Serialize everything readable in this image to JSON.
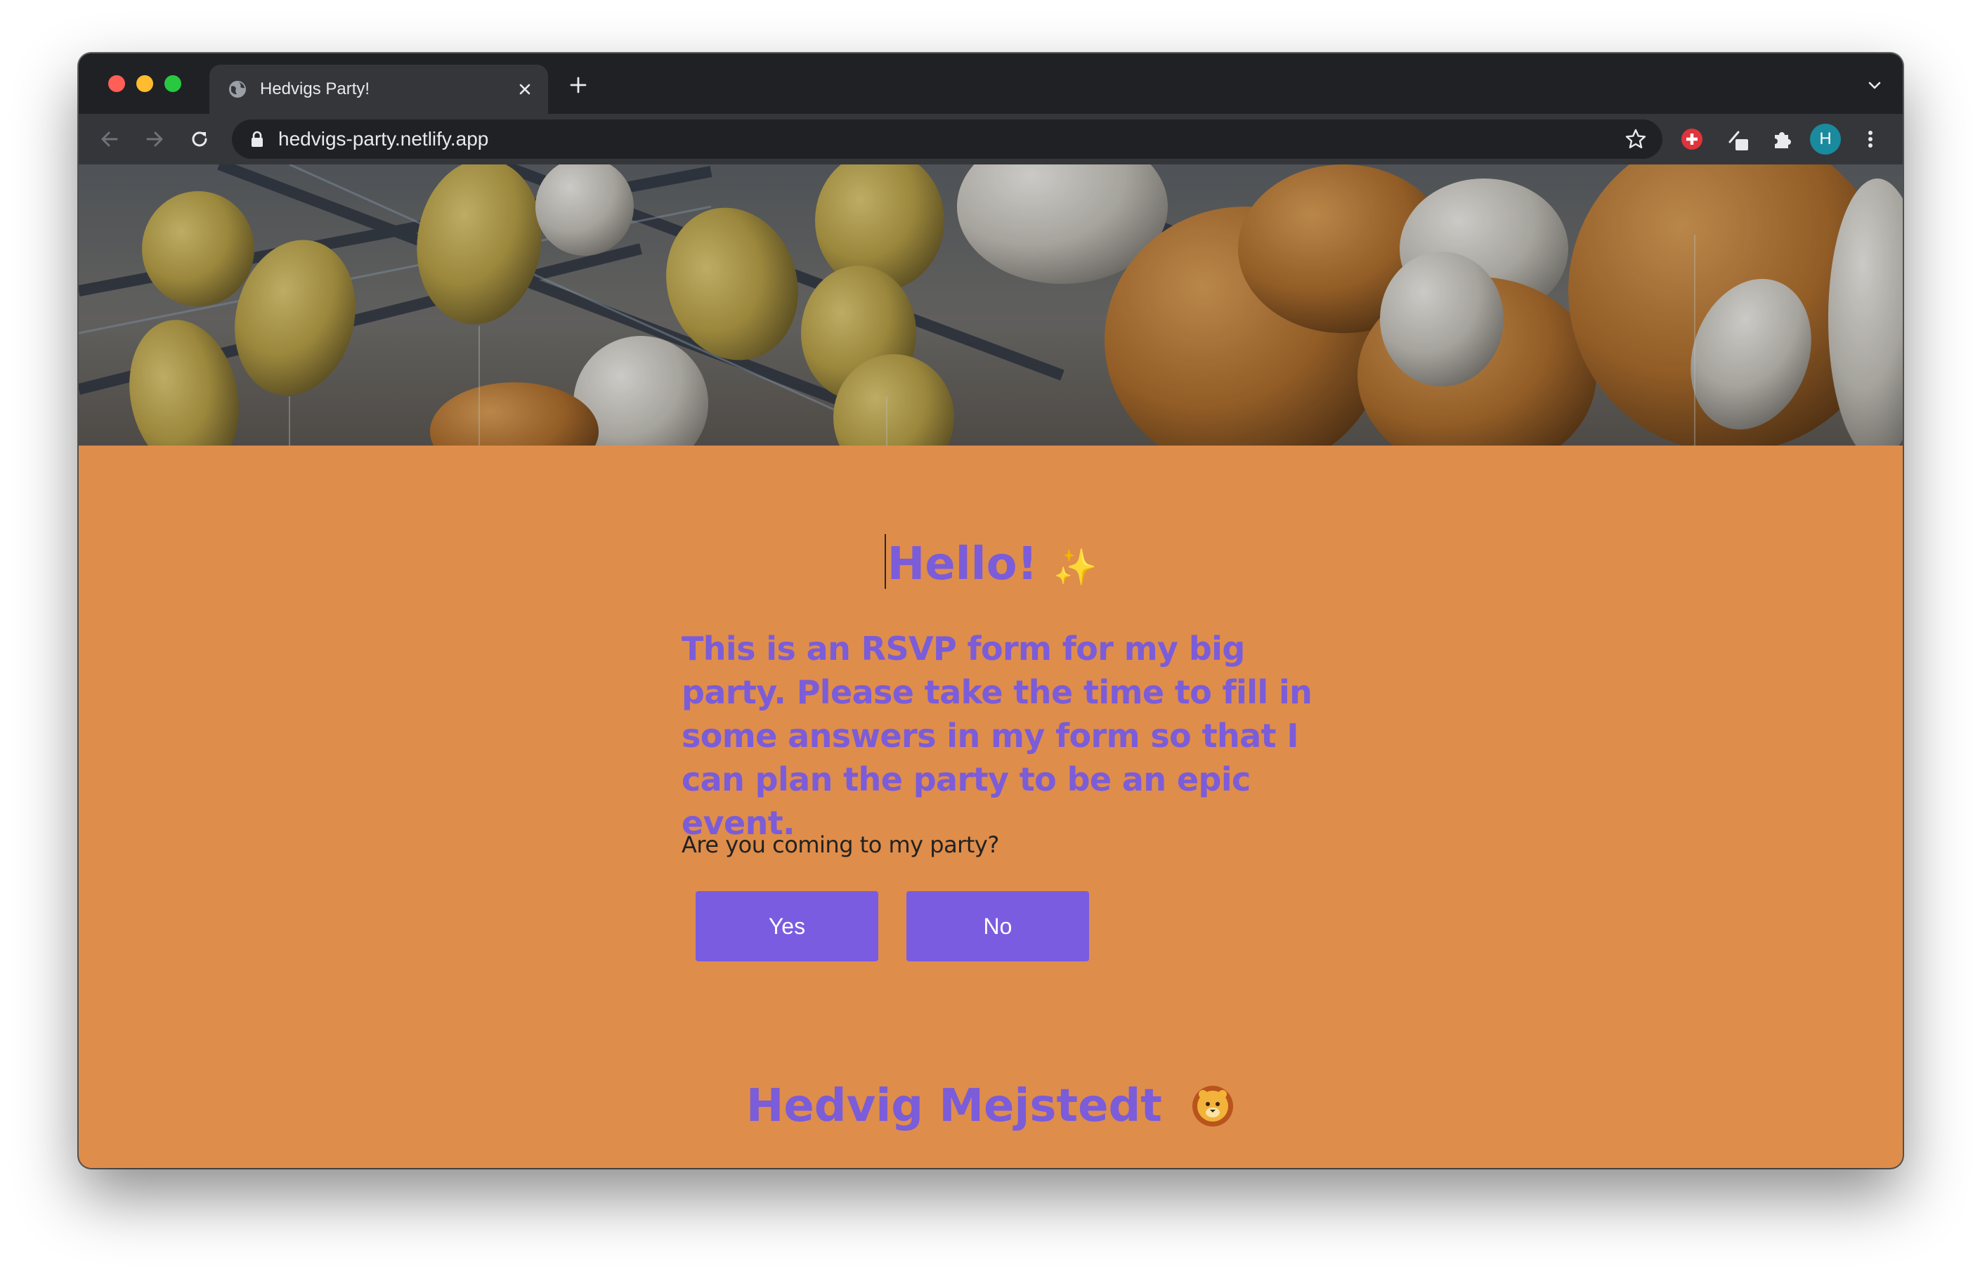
{
  "browser": {
    "tab_title": "Hedvigs Party!",
    "url": "hedvigs-party.netlify.app",
    "profile_initial": "H",
    "icons": [
      "globe-icon",
      "close-icon",
      "plus-icon",
      "chevron-down-icon",
      "back-arrow-icon",
      "forward-arrow-icon",
      "reload-icon",
      "lock-icon",
      "star-icon",
      "extension-red-cross-icon",
      "extension-pen-icon",
      "puzzle-icon",
      "kebab-menu-icon"
    ]
  },
  "page": {
    "greeting": "Hello!",
    "greeting_emoji": "✨",
    "intro": "This is an RSVP form for my big party. Please take the time to fill in some answers in my form so that I can plan the party to be an epic event.",
    "question": "Are you coming to my party?",
    "buttons": {
      "yes": "Yes",
      "no": "No"
    },
    "footer_name": "Hedvig Mejstedt",
    "footer_icon": "lion-face-icon"
  },
  "colors": {
    "page_background": "#df8d4b",
    "accent_purple": "#7b5cd9",
    "button_purple": "#7a5ce0",
    "browser_dark": "#202124",
    "browser_toolbar": "#35363a"
  }
}
